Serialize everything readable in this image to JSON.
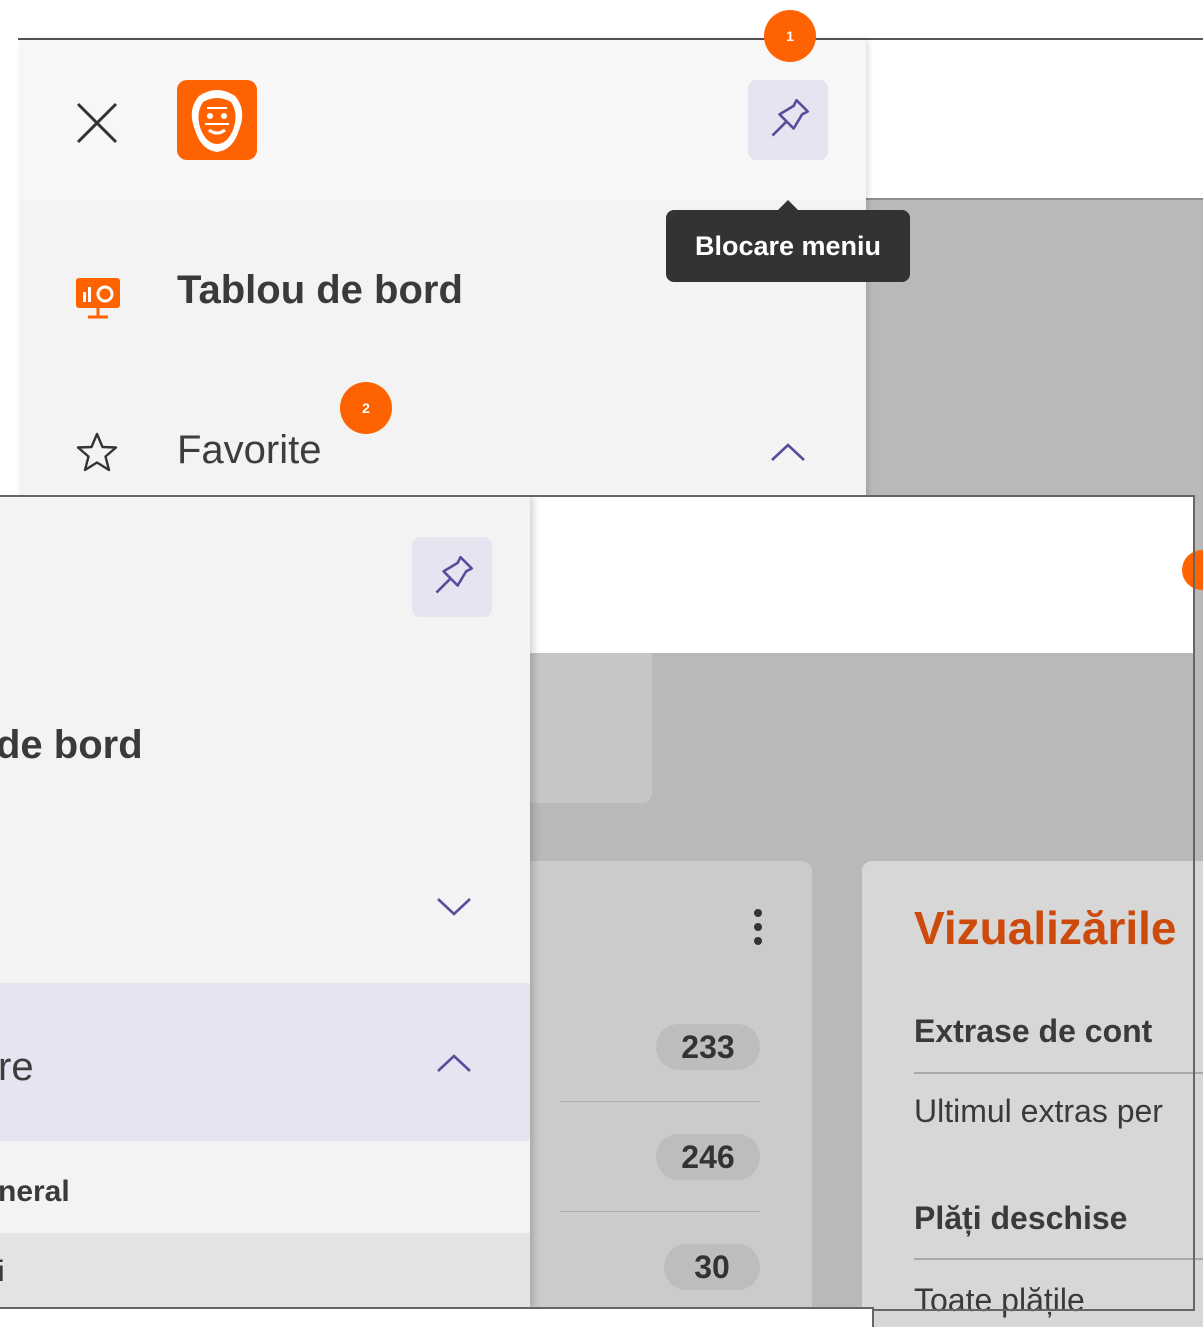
{
  "top_view": {
    "badge_1": "1",
    "badge_2": "2",
    "tooltip": "Blocare meniu",
    "menu": {
      "dashboard_label": "Tablou de bord",
      "favorites_label": "Favorite"
    }
  },
  "bottom_view": {
    "menu": {
      "dashboard_partial": "de bord",
      "active_partial": "re",
      "subitem_partial": "neral",
      "row_partial": "i"
    },
    "card_left": {
      "counts": [
        "233",
        "246",
        "30"
      ]
    },
    "card_right": {
      "title": "Vizualizările",
      "section1_title": "Extrase de cont",
      "section1_item": "Ultimul extras per",
      "section2_title": "Plăți deschise",
      "section2_item": "Toate plățile"
    }
  },
  "colors": {
    "brand_orange": "#ff6200",
    "pin_button_bg": "#e6e4f0",
    "active_item_bg": "#e6e4f0",
    "tooltip_bg": "#333333",
    "title_orange": "#cc4b0c"
  },
  "icons": [
    "close-icon",
    "ing-lion-logo",
    "pin-icon",
    "dashboard-icon",
    "star-icon",
    "chevron-up-icon",
    "chevron-down-icon",
    "kebab-menu-icon"
  ]
}
